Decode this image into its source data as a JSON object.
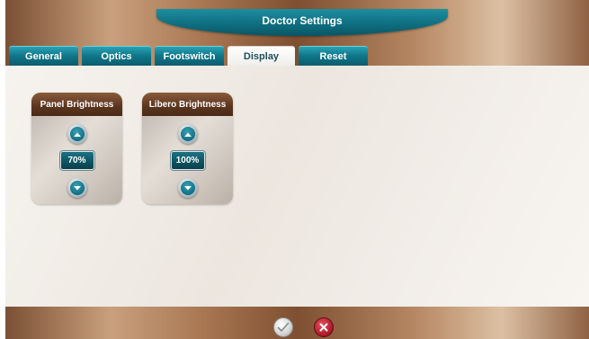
{
  "header": {
    "title": "Doctor Settings"
  },
  "tabs": [
    {
      "label": "General",
      "active": false
    },
    {
      "label": "Optics",
      "active": false
    },
    {
      "label": "Footswitch",
      "active": false
    },
    {
      "label": "Display",
      "active": true
    },
    {
      "label": "Reset",
      "active": false
    }
  ],
  "panels": {
    "panel_brightness": {
      "title": "Panel Brightness",
      "value": "70%",
      "up_icon": "chevron-up-icon",
      "down_icon": "chevron-down-icon"
    },
    "libero_brightness": {
      "title": "Libero Brightness",
      "value": "100%",
      "up_icon": "chevron-up-icon",
      "down_icon": "chevron-down-icon"
    }
  },
  "footer": {
    "confirm_icon": "checkmark-icon",
    "cancel_icon": "close-icon"
  },
  "colors": {
    "accent_teal": "#0f7588",
    "panel_header_brown": "#5a351f",
    "cancel_red": "#b71d2c"
  }
}
